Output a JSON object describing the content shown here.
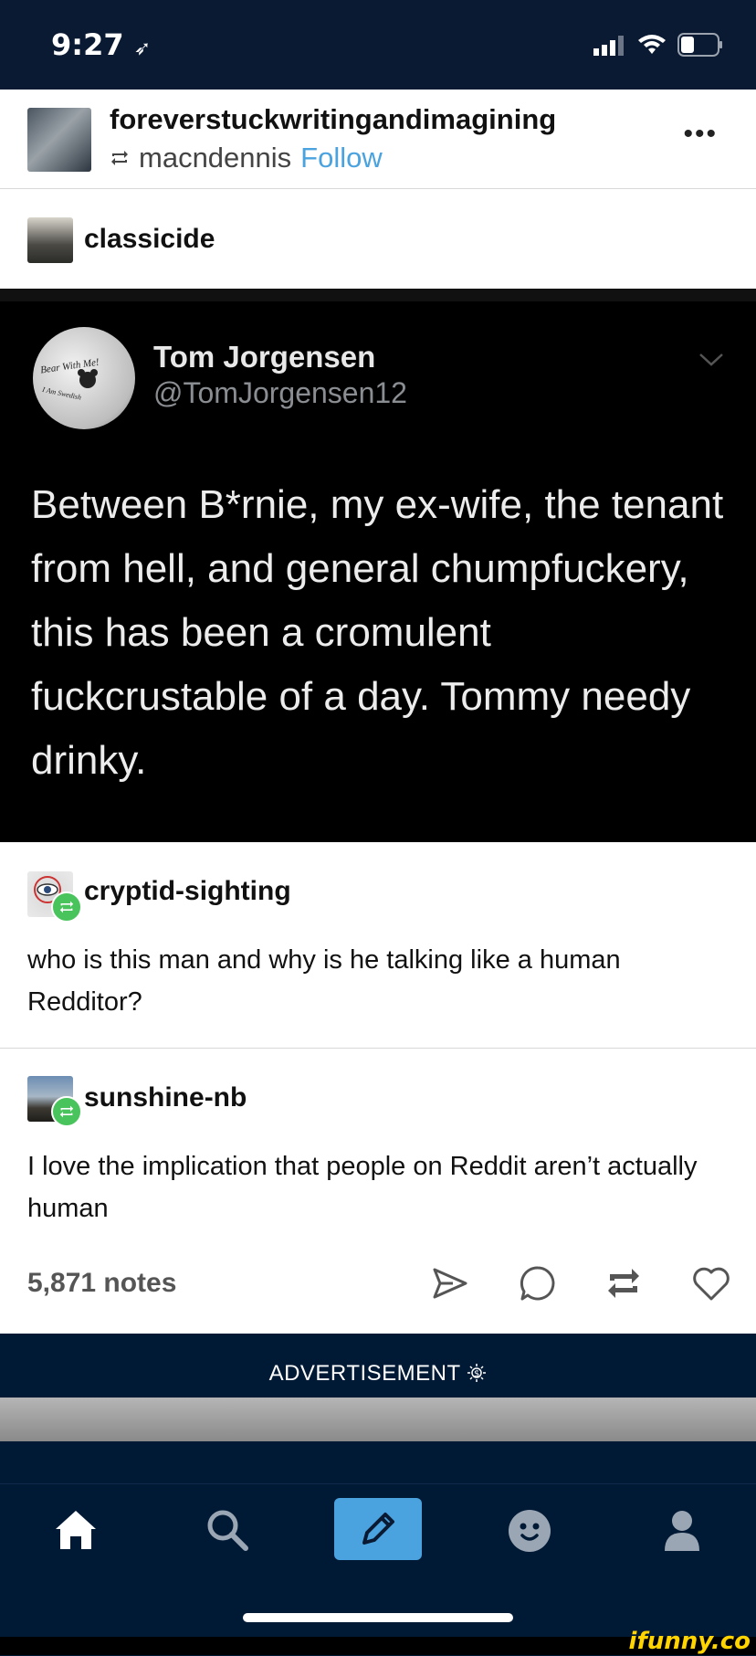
{
  "status_bar": {
    "time": "9:27",
    "location_glyph": "➶"
  },
  "post": {
    "blog_name": "foreverstuckwritingandimagining",
    "reblogged_from": "macndennis",
    "follow_label": "Follow",
    "more_label": "•••",
    "source_blog": "classicide",
    "tweet": {
      "name": "Tom Jorgensen",
      "handle": "@TomJorgensen12",
      "avatar_mug_text": "Bear With Me!",
      "avatar_mug_subtext": "I Am Swedish",
      "text": "Between B*rnie, my ex-wife, the tenant from hell, and general chumpfuckery, this has been a cromulent fuckcrustable of a day. Tommy needy drinky."
    },
    "comments": [
      {
        "user": "cryptid-sighting",
        "text": "who is this man and why is he talking like a human Redditor?"
      },
      {
        "user": "sunshine-nb",
        "text": "I love the implication that people on Reddit aren’t actually human"
      }
    ],
    "notes": "5,871 notes"
  },
  "ad": {
    "label": "ADVERTISEMENT"
  },
  "watermark": "ifunny.co",
  "colors": {
    "accent": "#4aa3df",
    "reblog_green": "#49c35b",
    "nav_bg": "#001935"
  }
}
